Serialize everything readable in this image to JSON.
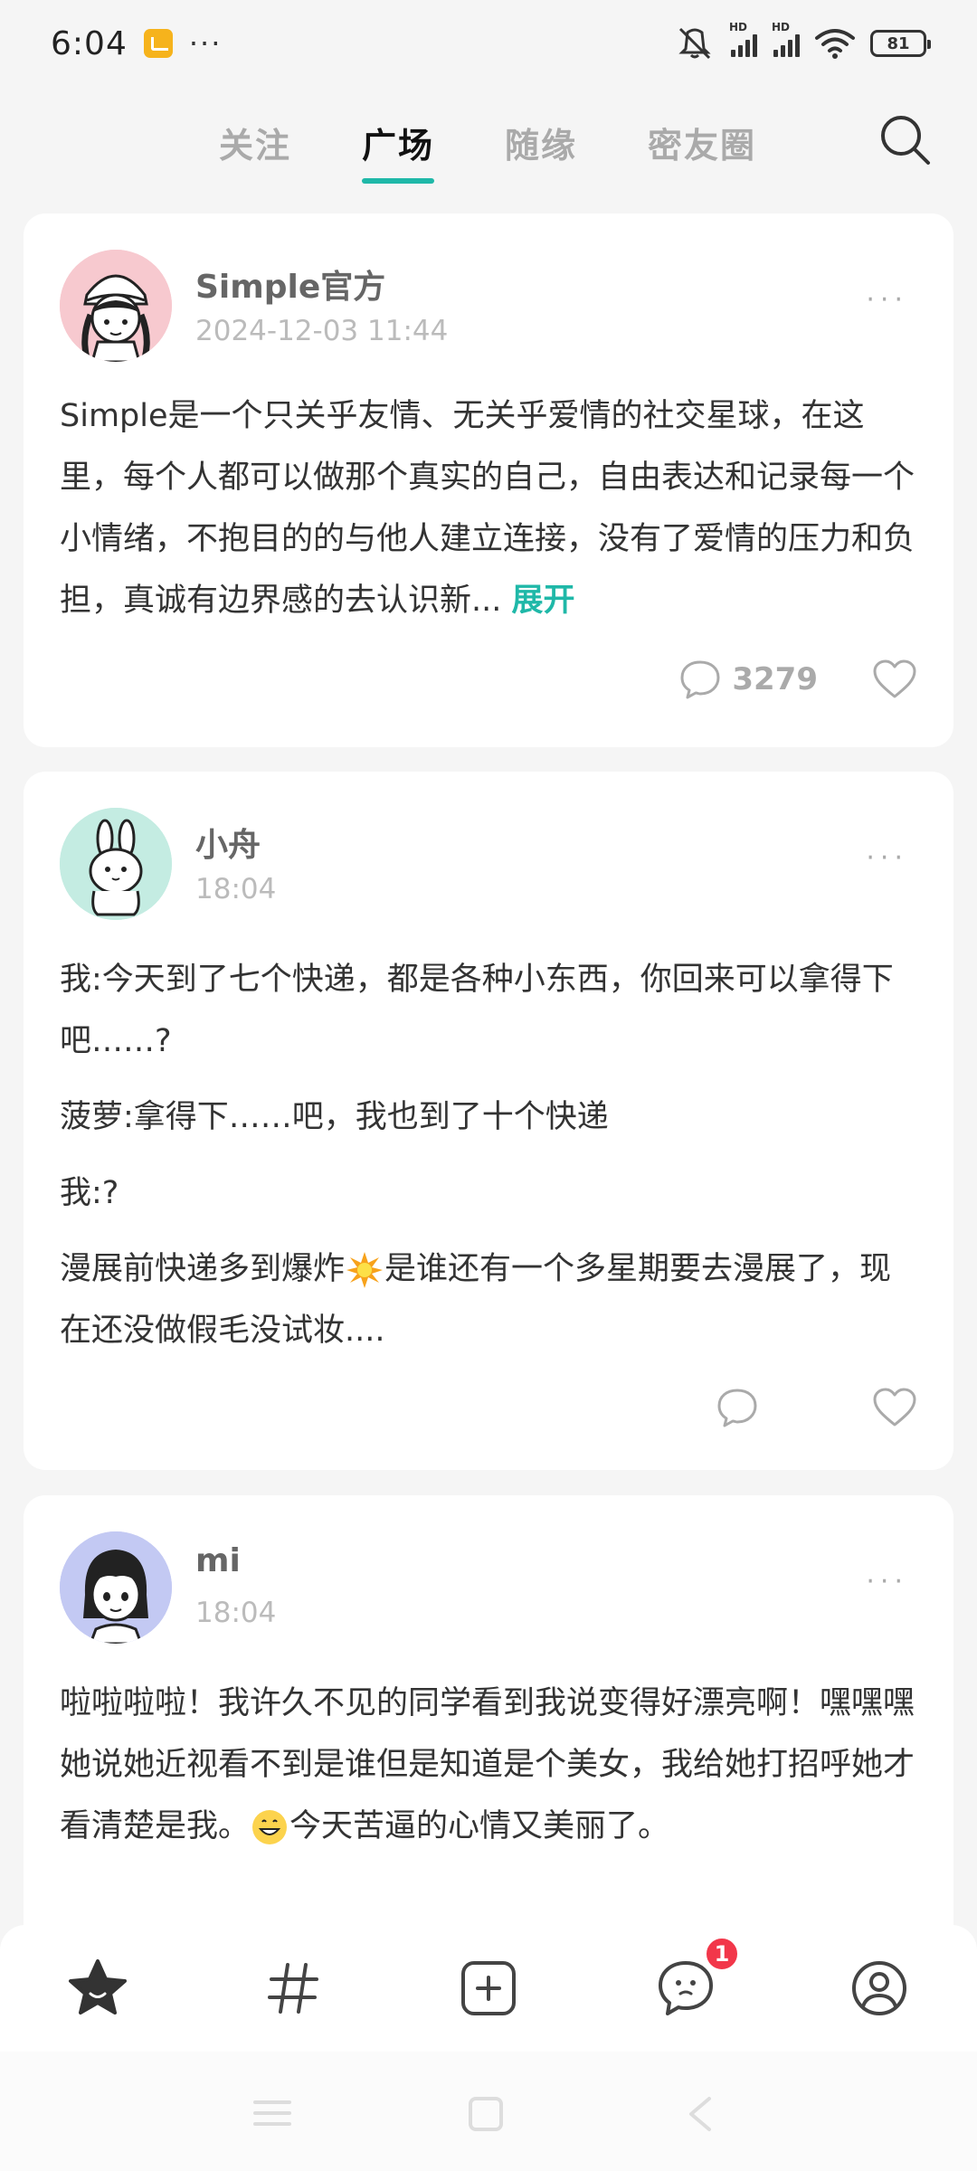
{
  "status_bar": {
    "time": "6:04",
    "dots": "···",
    "network_label": "HD",
    "battery": "81"
  },
  "top_tabs": [
    {
      "label": "关注",
      "active": false
    },
    {
      "label": "广场",
      "active": true
    },
    {
      "label": "随缘",
      "active": false
    },
    {
      "label": "密友圈",
      "active": false
    }
  ],
  "accent_color": "#1fb8a8",
  "posts": [
    {
      "author": "Simple官方",
      "time": "2024-12-03 11:44",
      "more": "···",
      "paragraphs": [
        "Simple是一个只关乎友情、无关乎爱情的社交星球，在这里，每个人都可以做那个真实的自己，自由表达和记录每一个小情绪，不抱目的的与他人建立连接，没有了爱情的压力和负担，真诚有边界感的去认识新..."
      ],
      "expand": "展开",
      "comment_count": "3279"
    },
    {
      "author": "小舟",
      "time": "18:04",
      "more": "···",
      "paragraphs": [
        "我:今天到了七个快递，都是各种小东西，你回来可以拿得下吧……?",
        "菠萝:拿得下……吧，我也到了十个快递",
        "我:?",
        "漫展前快递多到爆炸",
        "是谁还有一个多星期要去漫展了，现在还没做假毛没试妆...."
      ]
    },
    {
      "author": "mi",
      "time": "18:04",
      "more": "···",
      "paragraphs": [
        "啦啦啦啦！我许久不见的同学看到我说变得好漂亮啊！嘿嘿嘿她说她近视看不到是谁但是知道是个美女，我给她打招呼她才看清楚是我。",
        "今天苦逼的心情又美丽了。"
      ]
    }
  ],
  "bottom_nav": {
    "items": [
      "home-star",
      "topics-hash",
      "create-plus",
      "messages",
      "profile"
    ],
    "message_badge": "1"
  }
}
